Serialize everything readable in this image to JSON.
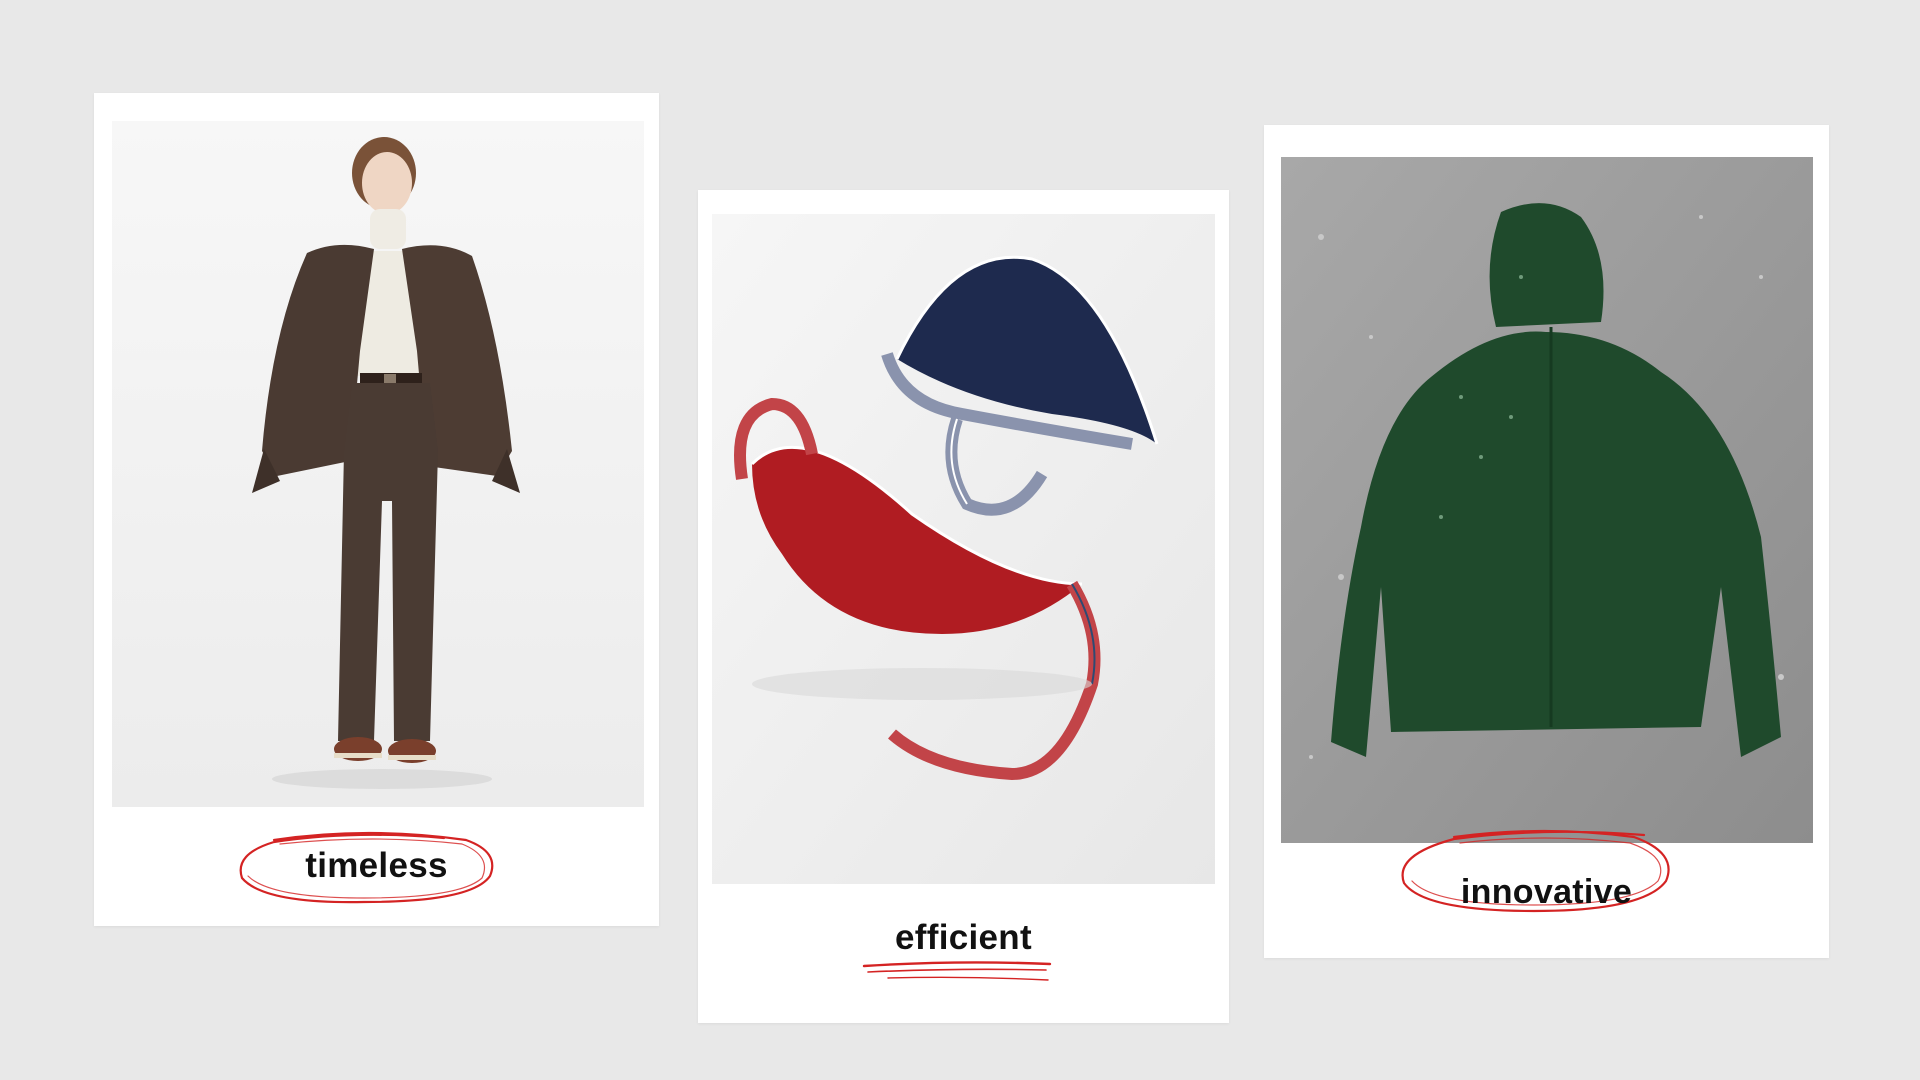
{
  "cards": [
    {
      "caption": "timeless",
      "product": "brown-wool-suit-outfit",
      "mark": "red-circle-scribble"
    },
    {
      "caption": "efficient",
      "product": "round-shoulder-bags",
      "mark": "red-underline-scribble"
    },
    {
      "caption": "innovative",
      "product": "green-hooded-rain-jacket",
      "mark": "red-circle-scribble"
    }
  ],
  "colors": {
    "background": "#e8e8e8",
    "card": "#ffffff",
    "scribble": "#d42323",
    "suit": "#4a3a32",
    "bag_red": "#b01c22",
    "bag_navy": "#1e2a4e",
    "jacket_green": "#1f4a2c"
  }
}
